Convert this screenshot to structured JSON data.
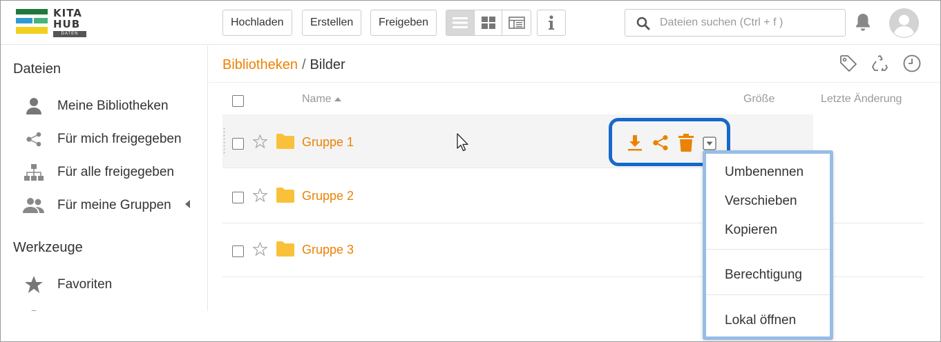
{
  "logo": {
    "line1": "KITA",
    "line2": "HUB",
    "tag": "DATEN",
    "colors": [
      "#1e7a3c",
      "#2f9ad6",
      "#f2cf1d"
    ]
  },
  "toolbar": {
    "upload_label": "Hochladen",
    "create_label": "Erstellen",
    "share_label": "Freigeben",
    "view_icons": [
      "list-view-icon",
      "grid-view-icon",
      "columns-view-icon"
    ],
    "info_icon": "info-icon"
  },
  "search": {
    "placeholder": "Dateien suchen (Ctrl + f )"
  },
  "sidebar": {
    "files_heading": "Dateien",
    "items": [
      {
        "label": "Meine Bibliotheken",
        "icon": "user-icon"
      },
      {
        "label": "Für mich freigegeben",
        "icon": "share-icon"
      },
      {
        "label": "Für alle freigegeben",
        "icon": "org-chart-icon"
      },
      {
        "label": "Für meine Gruppen",
        "icon": "group-icon"
      }
    ],
    "tools_heading": "Werkzeuge",
    "tools": [
      {
        "label": "Favoriten",
        "icon": "star-icon"
      }
    ]
  },
  "breadcrumb": {
    "root": "Bibliotheken",
    "separator": "/",
    "current": "Bilder"
  },
  "table": {
    "headers": {
      "name": "Name",
      "size": "Größe",
      "modified": "Letzte Änderung"
    },
    "rows": [
      {
        "name": "Gruppe 1"
      },
      {
        "name": "Gruppe 2"
      },
      {
        "name": "Gruppe 3"
      }
    ]
  },
  "row_actions": [
    "download-icon",
    "share-icon",
    "trash-icon",
    "more-dropdown-icon"
  ],
  "dropdown": {
    "items": [
      "Umbenennen",
      "Verschieben",
      "Kopieren",
      "Berechtigung",
      "Lokal öffnen"
    ]
  },
  "colors": {
    "accent": "#eb8205",
    "highlight_border": "#1668c9",
    "menu_border": "#96bde6",
    "folder": "#f9c13a"
  }
}
